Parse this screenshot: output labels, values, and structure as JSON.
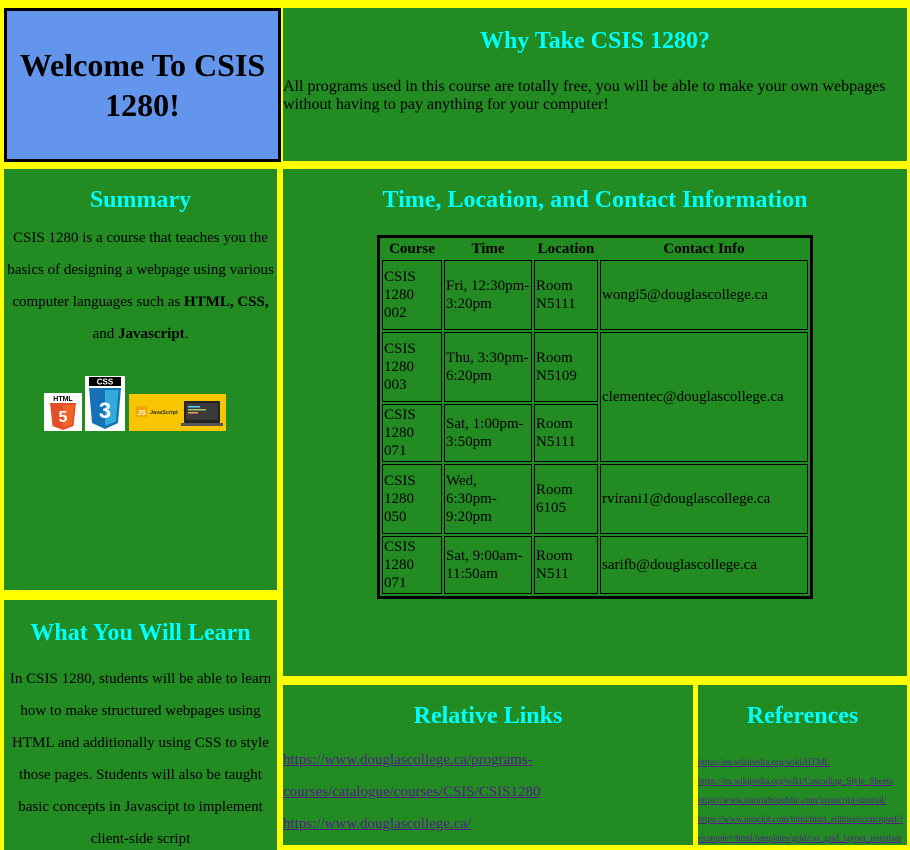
{
  "welcome": {
    "title": "Welcome To CSIS 1280!"
  },
  "why": {
    "heading": "Why Take CSIS 1280?",
    "text": "All programs used in this course are totally free, you will be able to make your own webpages without having to pay anything for your computer!"
  },
  "summary": {
    "heading": "Summary",
    "text_before": "CSIS 1280 is a course that teaches you the basics of designing a webpage using various computer languages such as ",
    "html": "HTML,",
    "css": "CSS,",
    "and": " and ",
    "js": "Javascript",
    "end": ".",
    "logos": {
      "html5_label": "HTML",
      "html5_number": "5",
      "css3_label": "CSS",
      "css3_number": "3",
      "js_label": "JavaScript"
    }
  },
  "info": {
    "heading": "Time, Location, and Contact Information",
    "headers": [
      "Course",
      "Time",
      "Location",
      "Contact Info"
    ],
    "rows": [
      {
        "course": "CSIS 1280 002",
        "time": "Fri, 12:30pm-3:20pm",
        "location": "Room N5111",
        "contact": "wongi5@douglascollege.ca"
      },
      {
        "course": "CSIS 1280 003",
        "time": "Thu, 3:30pm-6:20pm",
        "location": "Room N5109",
        "contact": "clementec@douglascollege.ca"
      },
      {
        "course": "CSIS 1280 071",
        "time": "Sat, 1:00pm-3:50pm",
        "location": "Room N5111",
        "contact": ""
      },
      {
        "course": "CSIS 1280 050",
        "time": "Wed, 6:30pm-9:20pm",
        "location": "Room 6105",
        "contact": "rvirani1@douglascollege.ca"
      },
      {
        "course": "CSIS 1280 071",
        "time": "Sat, 9:00am-11:50am",
        "location": "Room N511",
        "contact": "sarifb@douglascollege.ca"
      }
    ]
  },
  "learn": {
    "heading": "What You Will Learn",
    "text": "In CSIS 1280, students will be able to learn how to make structured webpages using HTML and additionally using CSS to style those pages. Students will also be taught basic concepts in Javascipt to implement client-side script"
  },
  "links": {
    "heading": "Relative Links",
    "items": [
      "https://www.douglascollege.ca/programs-",
      "courses/catalogue/courses/CSIS/CSIS1280",
      "https://www.douglascollege.ca/"
    ]
  },
  "refs": {
    "heading": "References",
    "items": [
      "https://en.wikipedia.org/wiki/HTML",
      "https://en.wikipedia.org/wiki/Cascading_Style_Sheets",
      "https://www.tutorialrepublic.com/javascript-tutorial/",
      "https://www.quackit.com/html/html_editors/scratchpad/?",
      "example=/html/templates/grid/css_grid_layout_template"
    ]
  },
  "colors": {
    "page_bg": "#ffff00",
    "panel_bg": "#228b22",
    "heading": "#00ffff",
    "welcome_bg": "#6495ed",
    "link": "#551a8b"
  }
}
